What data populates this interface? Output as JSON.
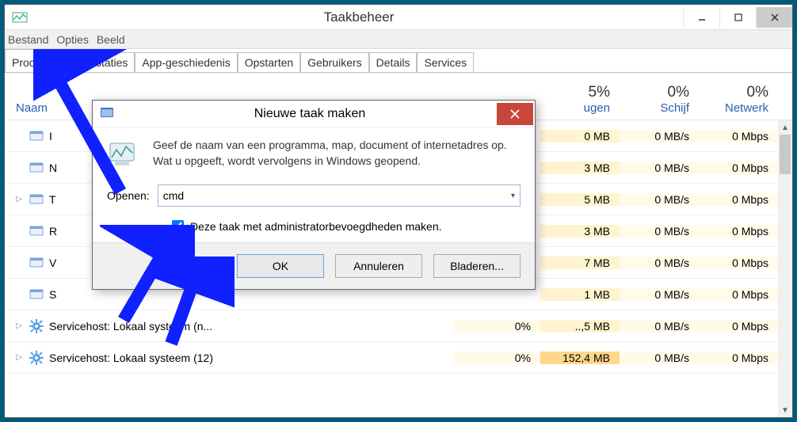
{
  "window": {
    "title": "Taakbeheer"
  },
  "menu": {
    "file": "Bestand",
    "options": "Opties",
    "view": "Beeld"
  },
  "tabs": {
    "t0": "Processen",
    "t1": "Prestaties",
    "t2": "App-geschiedenis",
    "t3": "Opstarten",
    "t4": "Gebruikers",
    "t5": "Details",
    "t6": "Services"
  },
  "columns": {
    "name": "Naam",
    "memory": {
      "pct": "5%",
      "label": "ugen"
    },
    "disk": {
      "pct": "0%",
      "label": "Schijf"
    },
    "network": {
      "pct": "0%",
      "label": "Netwerk"
    }
  },
  "rows": [
    {
      "name": "I",
      "mem": "0 MB",
      "disk": "0 MB/s",
      "net": "0 Mbps",
      "memhl": "hl-med"
    },
    {
      "name": "N",
      "mem": "3 MB",
      "disk": "0 MB/s",
      "net": "0 Mbps",
      "memhl": "hl-med"
    },
    {
      "name": "T",
      "mem": "5 MB",
      "disk": "0 MB/s",
      "net": "0 Mbps",
      "memhl": "hl-med",
      "tri": true
    },
    {
      "name": "R",
      "mem": "3 MB",
      "disk": "0 MB/s",
      "net": "0 Mbps",
      "memhl": "hl-med"
    },
    {
      "name": "V",
      "mem": "7 MB",
      "disk": "0 MB/s",
      "net": "0 Mbps",
      "memhl": "hl-med"
    },
    {
      "name": "S",
      "mem": "1 MB",
      "disk": "0 MB/s",
      "net": "0 Mbps",
      "memhl": "hl-med"
    },
    {
      "name": "Servicehost: Lokaal systeem (n...",
      "cpu": "0%",
      "mem": "..,5 MB",
      "disk": "0 MB/s",
      "net": "0 Mbps",
      "memhl": "hl-med",
      "tri": true,
      "gear": true
    },
    {
      "name": "Servicehost: Lokaal systeem (12)",
      "cpu": "0%",
      "mem": "152,4 MB",
      "disk": "0 MB/s",
      "net": "0 Mbps",
      "memhl": "hl-dark",
      "tri": true,
      "gear": true
    }
  ],
  "dialog": {
    "title": "Nieuwe taak maken",
    "body": "Geef de naam van een programma, map, document of internetadres op. Wat u opgeeft, wordt vervolgens in Windows geopend.",
    "open_label": "Openen:",
    "open_value": "cmd",
    "admin_label": "Deze taak met administratorbevoegdheden maken.",
    "admin_checked": true,
    "ok": "OK",
    "cancel": "Annuleren",
    "browse": "Bladeren..."
  }
}
